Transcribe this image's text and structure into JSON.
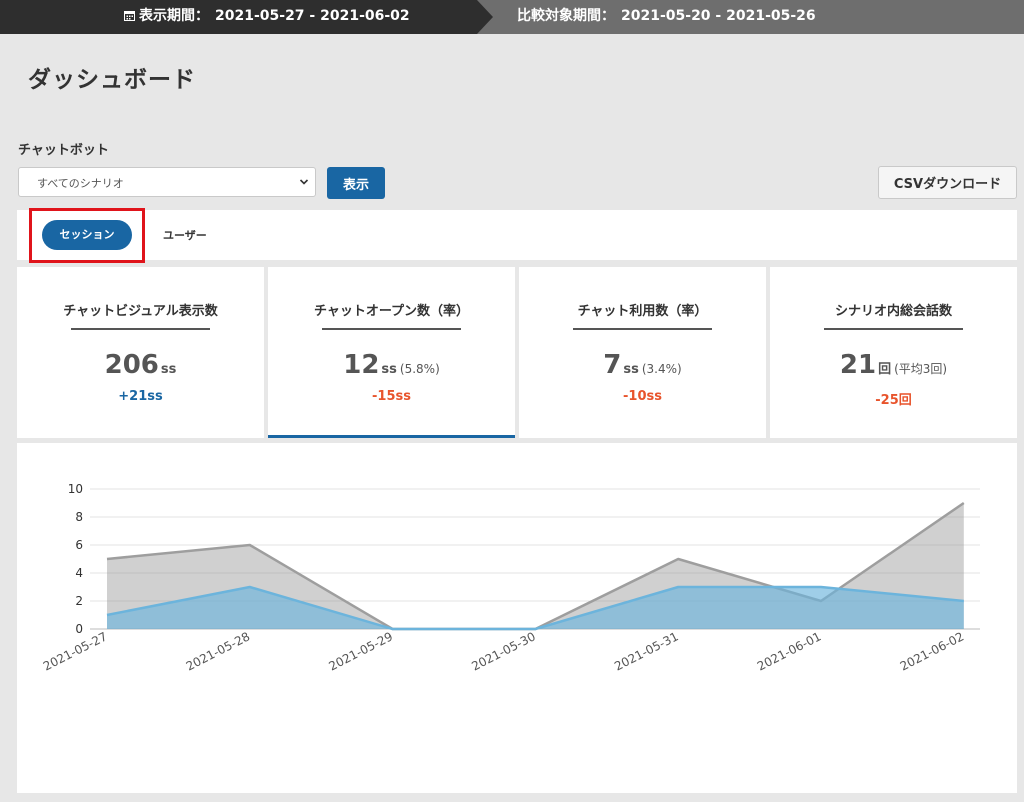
{
  "header": {
    "display_period_label": "表示期間：",
    "display_period_value": "2021-05-27 - 2021-06-02",
    "compare_period_label": "比較対象期間：",
    "compare_period_value": "2021-05-20 - 2021-05-26"
  },
  "page": {
    "title": "ダッシュボード"
  },
  "filters": {
    "label": "チャットボット",
    "scenario_selected": "すべてのシナリオ",
    "show_button": "表示",
    "csv_button": "CSVダウンロード"
  },
  "tabs": [
    {
      "label": "セッション",
      "active": true
    },
    {
      "label": "ユーザー",
      "active": false
    }
  ],
  "cards": [
    {
      "title": "チャットビジュアル表示数",
      "value": "206",
      "unit": "ss",
      "rate": "",
      "diff": "+21ss"
    },
    {
      "title": "チャットオープン数（率）",
      "value": "12",
      "unit": "ss",
      "rate": "(5.8%)",
      "diff": "-15ss"
    },
    {
      "title": "チャット利用数（率）",
      "value": "7",
      "unit": "ss",
      "rate": "(3.4%)",
      "diff": "-10ss"
    },
    {
      "title": "シナリオ内総会話数",
      "value": "21",
      "unit": "回",
      "rate": "(平均3回)",
      "diff": "-25回"
    }
  ],
  "colors": {
    "primary": "#1966a3",
    "negative": "#e8542c",
    "highlight": "#e0141b",
    "compare_series": "#9e9e9e",
    "current_series": "#6cb4dc"
  },
  "icons": {
    "calendar": "calendar-icon",
    "select_arrow": "chevron-down-icon"
  },
  "chart_data": {
    "type": "area",
    "x": [
      "2021-05-27",
      "2021-05-28",
      "2021-05-29",
      "2021-05-30",
      "2021-05-31",
      "2021-06-01",
      "2021-06-02"
    ],
    "series": [
      {
        "values": [
          5,
          6,
          0,
          0,
          5,
          2,
          9
        ]
      },
      {
        "values": [
          1,
          3,
          0,
          0,
          3,
          3,
          2
        ]
      }
    ],
    "ylim": [
      0,
      10
    ],
    "yticks": [
      0,
      2,
      4,
      6,
      8,
      10
    ],
    "grid": true
  }
}
